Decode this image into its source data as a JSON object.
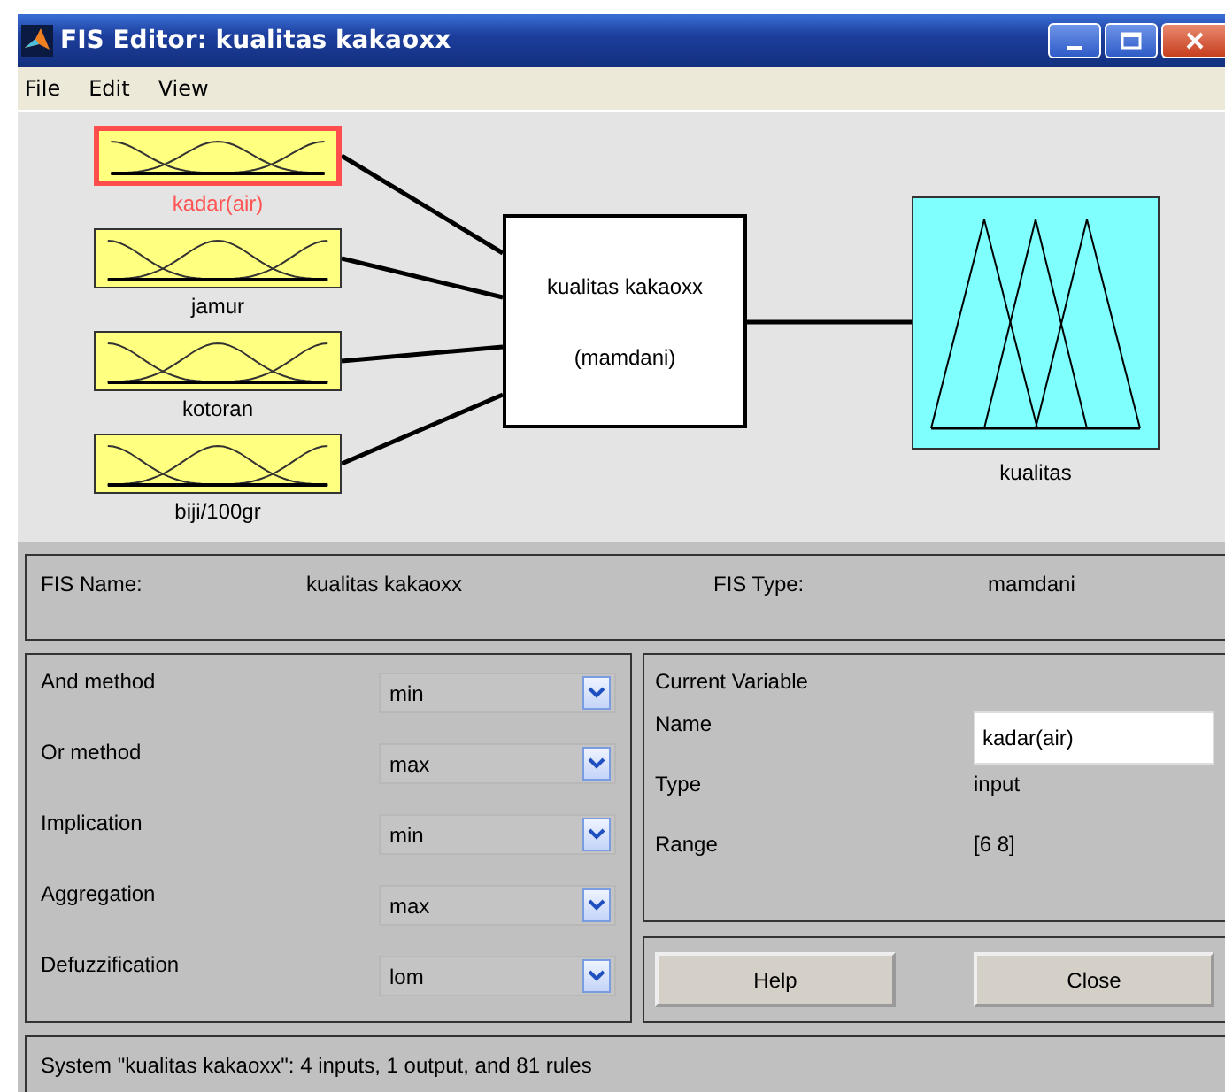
{
  "window": {
    "title": "FIS Editor: kualitas kakaoxx"
  },
  "menu": [
    "File",
    "Edit",
    "View"
  ],
  "inputs": [
    {
      "label": "kadar(air)",
      "selected": true
    },
    {
      "label": "jamur",
      "selected": false
    },
    {
      "label": "kotoran",
      "selected": false
    },
    {
      "label": "biji/100gr",
      "selected": false
    }
  ],
  "system_box": {
    "name": "kualitas kakaoxx",
    "type": "(mamdani)"
  },
  "outputs": [
    {
      "label": "kualitas",
      "selected": false
    }
  ],
  "fis_info": {
    "name_label": "FIS Name:",
    "name": "kualitas kakaoxx",
    "type_label": "FIS Type:",
    "type": "mamdani"
  },
  "methods": [
    {
      "label": "And method",
      "value": "min"
    },
    {
      "label": "Or method",
      "value": "max"
    },
    {
      "label": "Implication",
      "value": "min"
    },
    {
      "label": "Aggregation",
      "value": "max"
    },
    {
      "label": "Defuzzification",
      "value": "lom"
    }
  ],
  "current_variable": {
    "title": "Current Variable",
    "name_label": "Name",
    "name": "kadar(air)",
    "type_label": "Type",
    "type": "input",
    "range_label": "Range",
    "range": "[6 8]"
  },
  "buttons": [
    "Help",
    "Close"
  ],
  "status_bar": "System \"kualitas kakaoxx\": 4 inputs, 1 output, and 81 rules"
}
